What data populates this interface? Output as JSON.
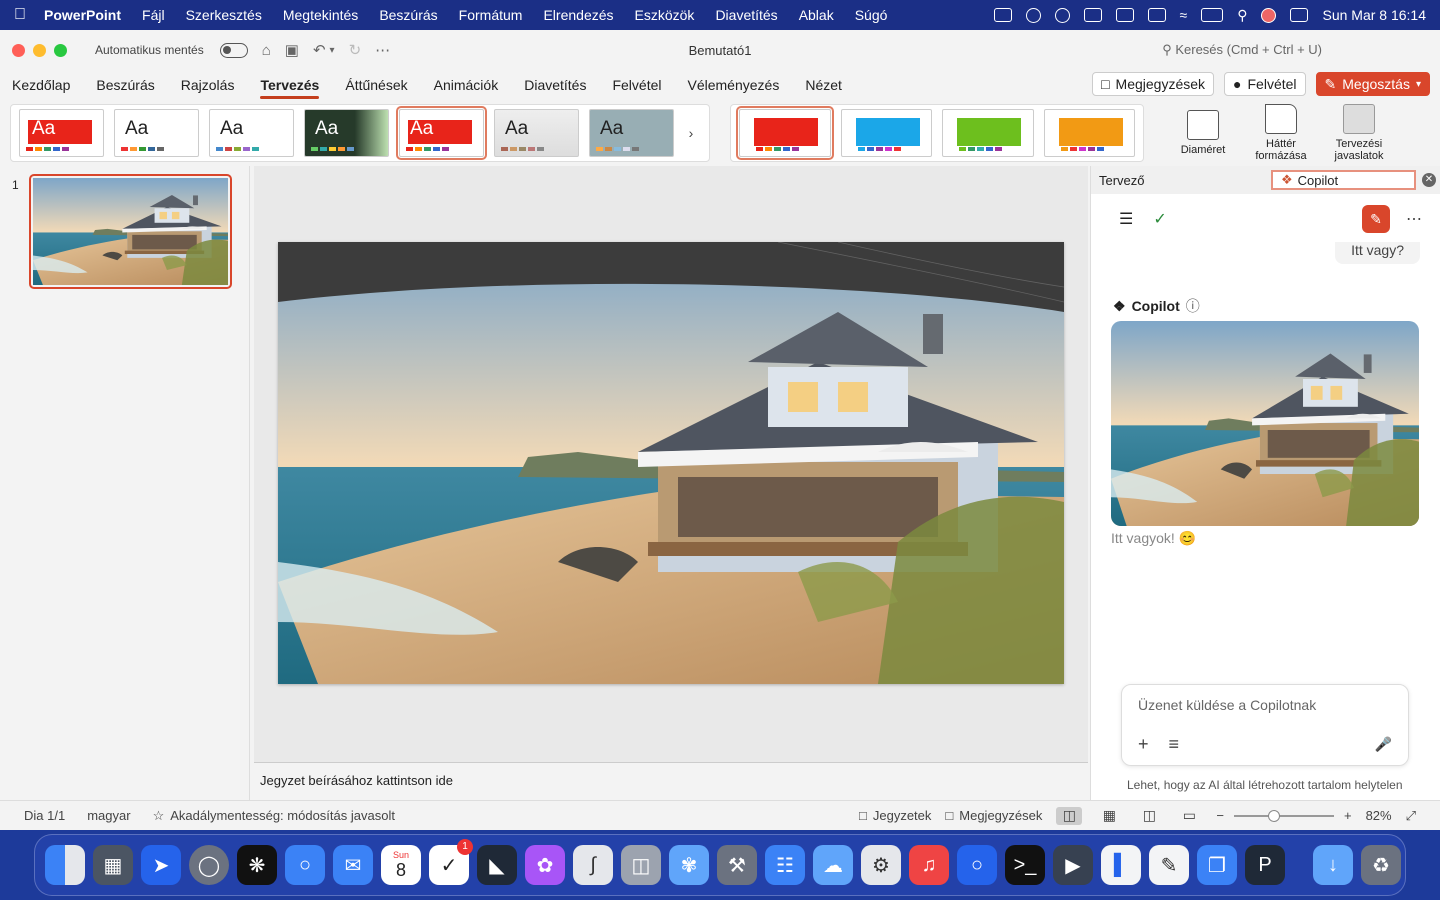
{
  "menubar": {
    "app": "PowerPoint",
    "items": [
      "Fájl",
      "Szerkesztés",
      "Megtekintés",
      "Beszúrás",
      "Formátum",
      "Elrendezés",
      "Eszközök",
      "Diavetítés",
      "Ablak",
      "Súgó"
    ],
    "clock": "Sun Mar 8  16:14"
  },
  "titlebar": {
    "autosave": "Automatikus mentés",
    "title": "Bemutató1",
    "search": "Keresés (Cmd + Ctrl + U)"
  },
  "tabs": [
    "Kezdőlap",
    "Beszúrás",
    "Rajzolás",
    "Tervezés",
    "Áttűnések",
    "Animációk",
    "Diavetítés",
    "Felvétel",
    "Véleményezés",
    "Nézet"
  ],
  "tab_actions": {
    "comments": "Megjegyzések",
    "record": "Felvétel",
    "share": "Megosztás"
  },
  "ribbon": {
    "theme_label": "Aa",
    "slide_size": "Diaméret",
    "format_bg": "Háttér formázása",
    "designer": "Tervezési javaslatok"
  },
  "slides": {
    "number": "1"
  },
  "notes": {
    "placeholder": "Jegyzet beírásához kattintson ide"
  },
  "panel": {
    "tab_designer": "Tervező",
    "tab_copilot": "Copilot",
    "user_msg": "Itt vagy?",
    "copilot_label": "Copilot",
    "reply": "Itt vagyok! 😊",
    "composer_placeholder": "Üzenet küldése a Copilotnak",
    "disclaimer": "Lehet, hogy az AI által létrehozott tartalom helytelen"
  },
  "status": {
    "slide": "Dia 1/1",
    "language": "magyar",
    "accessibility": "Akadálymentesség: módosítás javasolt",
    "notes": "Jegyzetek",
    "comments": "Megjegyzések",
    "zoom": "82%"
  },
  "dock": {
    "calendar_day": "Sun",
    "calendar_date": "8",
    "reminders_badge": "1"
  },
  "colors": {
    "accent": "#d9462b",
    "menubar": "#1b2f86"
  }
}
